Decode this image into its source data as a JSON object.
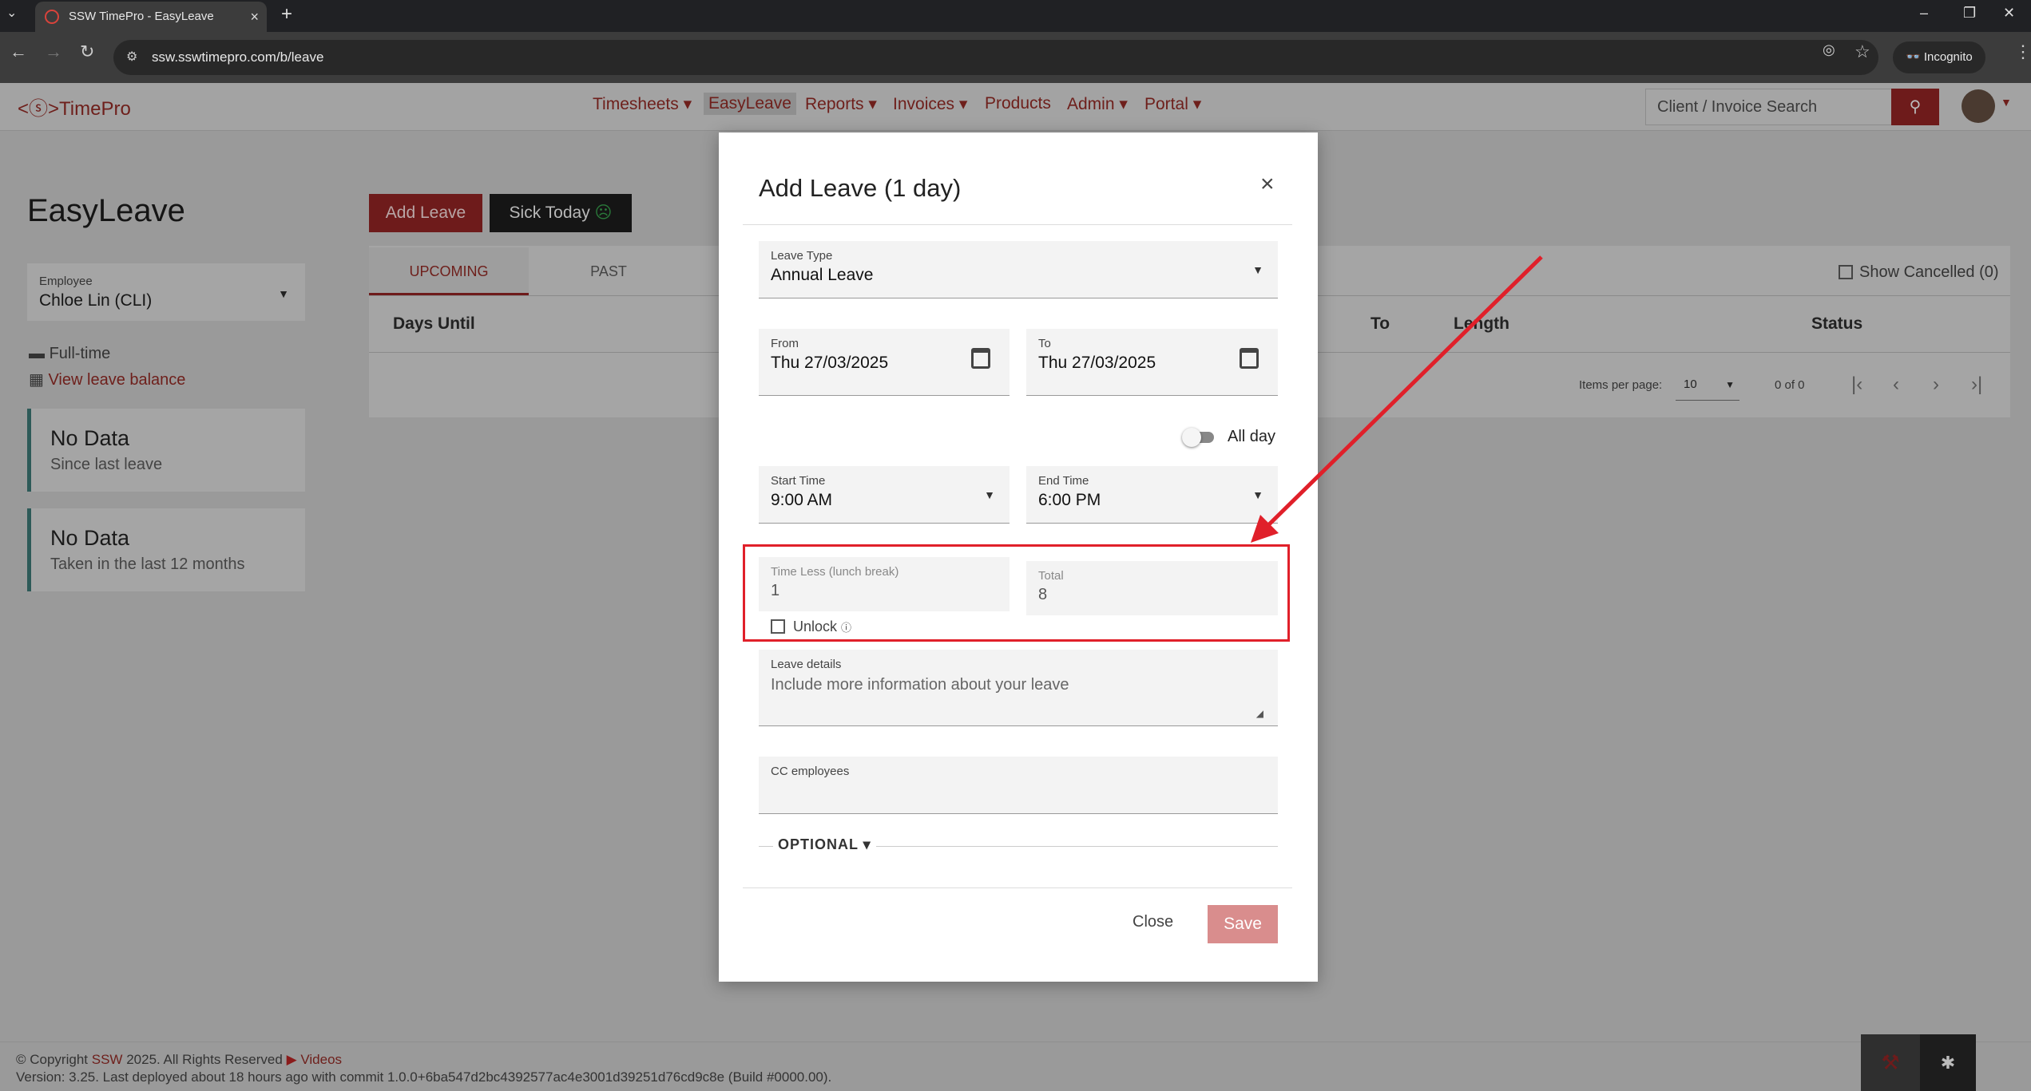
{
  "browser": {
    "tab_title": "SSW TimePro - EasyLeave",
    "url": "ssw.sswtimepro.com/b/leave",
    "incognito_label": "Incognito"
  },
  "app": {
    "logo": "TimePro",
    "logo_mark": "<ⓢ>",
    "menu": [
      {
        "label": "Timesheets ▾"
      },
      {
        "label": "EasyLeave"
      },
      {
        "label": "Reports ▾"
      },
      {
        "label": "Invoices ▾"
      },
      {
        "label": "Products"
      },
      {
        "label": "Admin ▾"
      },
      {
        "label": "Portal ▾"
      }
    ],
    "search_placeholder": "Client / Invoice Search"
  },
  "page": {
    "title": "EasyLeave",
    "employee_label": "Employee",
    "employee_value": "Chloe Lin (CLI)",
    "employment_type": "Full-time",
    "view_balance": "View leave balance",
    "cards": [
      {
        "title": "No Data",
        "subtitle": "Since last leave"
      },
      {
        "title": "No Data",
        "subtitle": "Taken in the last 12 months"
      }
    ],
    "add_leave": "Add Leave",
    "sick_today": "Sick Today",
    "tabs": [
      "UPCOMING",
      "PAST"
    ],
    "show_cancelled": "Show Cancelled (0)",
    "columns": [
      "Days Until",
      "To",
      "Length",
      "Status"
    ],
    "items_per_page_label": "Items per page:",
    "items_per_page": "10",
    "range": "0 of 0"
  },
  "modal": {
    "title": "Add Leave (1 day)",
    "leave_type_label": "Leave Type",
    "leave_type_value": "Annual Leave",
    "from_label": "From",
    "from_value": "Thu 27/03/2025",
    "to_label": "To",
    "to_value": "Thu 27/03/2025",
    "all_day_label": "All day",
    "start_label": "Start Time",
    "start_value": "9:00 AM",
    "end_label": "End Time",
    "end_value": "6:00 PM",
    "time_less_label": "Time Less (lunch break)",
    "time_less_value": "1",
    "total_label": "Total",
    "total_value": "8",
    "unlock_label": "Unlock",
    "details_label": "Leave details",
    "details_placeholder": "Include more information about your leave",
    "cc_label": "CC employees",
    "optional_label": "OPTIONAL ▾",
    "close_label": "Close",
    "save_label": "Save"
  },
  "footer": {
    "copyright_pre": "© Copyright",
    "copyright_link": "SSW",
    "copyright_post": "2025. All Rights Reserved",
    "videos": "Videos",
    "version": "Version: 3.25. Last deployed about 18 hours ago with commit 1.0.0+6ba547d2bc4392577ac4e3001d39251d76cd9c8e (Build #0000.00)."
  },
  "colors": {
    "brand": "#c0302b",
    "annotation": "#e0202a"
  }
}
